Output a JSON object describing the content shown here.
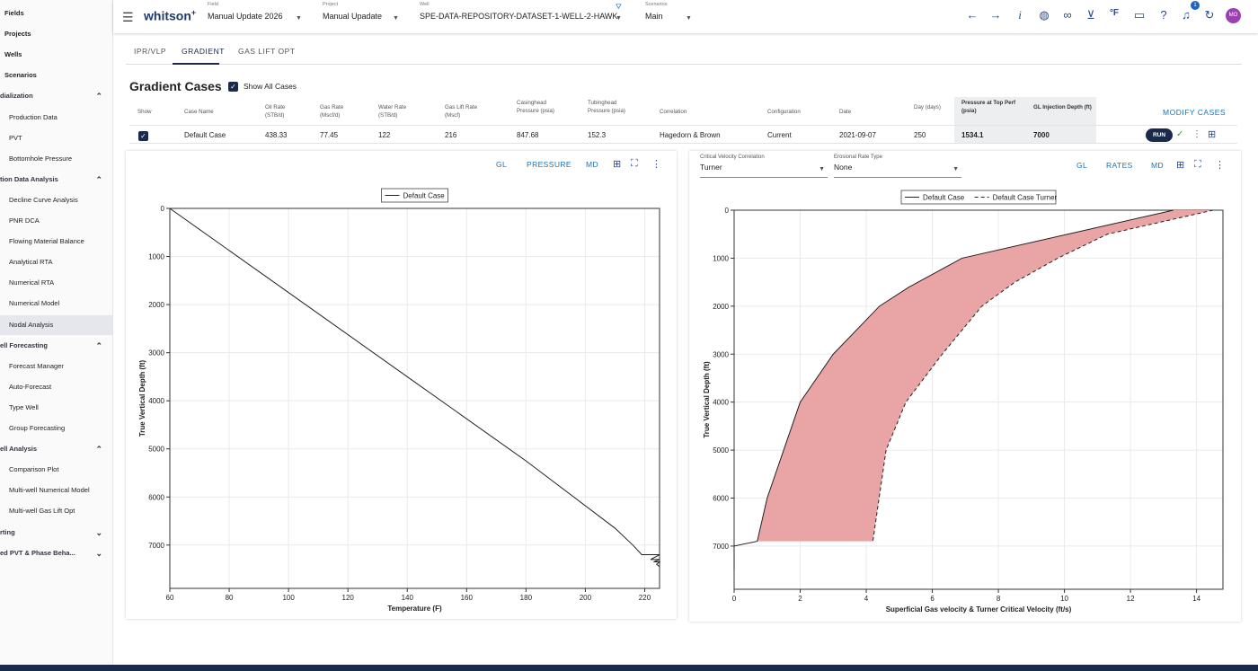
{
  "sidebar": {
    "items": [
      {
        "label": "Fields",
        "kind": "top"
      },
      {
        "label": "Projects",
        "kind": "top"
      },
      {
        "label": "Wells",
        "kind": "top"
      },
      {
        "label": "Scenarios",
        "kind": "top"
      },
      {
        "label": "dialization",
        "kind": "sec",
        "chevron": "⌃"
      },
      {
        "label": "Production Data",
        "kind": "sub"
      },
      {
        "label": "PVT",
        "kind": "sub"
      },
      {
        "label": "Bottomhole Pressure",
        "kind": "sub"
      },
      {
        "label": "tion Data Analysis",
        "kind": "sec",
        "chevron": "⌃"
      },
      {
        "label": "Decline Curve Analysis",
        "kind": "sub"
      },
      {
        "label": "PNR DCA",
        "kind": "sub"
      },
      {
        "label": "Flowing Material Balance",
        "kind": "sub"
      },
      {
        "label": "Analytical RTA",
        "kind": "sub"
      },
      {
        "label": "Numerical RTA",
        "kind": "sub"
      },
      {
        "label": "Numerical Model",
        "kind": "sub"
      },
      {
        "label": "Nodal Analysis",
        "kind": "sub",
        "active": true
      },
      {
        "label": "ell Forecasting",
        "kind": "sec",
        "chevron": "⌃"
      },
      {
        "label": "Forecast Manager",
        "kind": "sub"
      },
      {
        "label": "Auto-Forecast",
        "kind": "sub"
      },
      {
        "label": "Type Well",
        "kind": "sub"
      },
      {
        "label": "Group Forecasting",
        "kind": "sub"
      },
      {
        "label": "ell Analysis",
        "kind": "sec",
        "chevron": "⌃"
      },
      {
        "label": "Comparison Plot",
        "kind": "sub"
      },
      {
        "label": "Multi-well Numerical Model",
        "kind": "sub"
      },
      {
        "label": "Multi-well Gas Lift Opt",
        "kind": "sub"
      },
      {
        "label": "rting",
        "kind": "sec",
        "chevron": "⌄"
      },
      {
        "label": "ed PVT & Phase Beha...",
        "kind": "sec",
        "chevron": "⌄"
      }
    ]
  },
  "topbar": {
    "logo": "whitson",
    "logo_sup": "+",
    "field_label": "Field",
    "field_value": "Manual Update 2026",
    "project_label": "Project",
    "project_value": "Manual Upadate",
    "well_label": "Well",
    "well_value": "SPE-DATA-REPOSITORY-DATASET-1-WELL-2-HAWK",
    "scenarios_label": "Scenarios",
    "scenarios_value": "Main",
    "notif_count": "1",
    "avatar": "MO",
    "icons": [
      "arrow-left-icon",
      "arrow-right-icon",
      "info-icon",
      "globe-icon",
      "link-icon",
      "download-icon",
      "temperature-unit-icon",
      "feedback-icon",
      "help-icon",
      "bell-icon",
      "refresh-icon"
    ],
    "temp_unit": "°F",
    "info_glyph": "i"
  },
  "tabs": [
    "IPR/VLP",
    "GRADIENT",
    "GAS LIFT OPT"
  ],
  "cases": {
    "title": "Gradient Cases",
    "show_all_label": "Show All Cases",
    "modify_label": "MODIFY CASES",
    "run_label": "RUN",
    "headers": [
      "Show",
      "Case Name",
      "Oil Rate (STB/d)",
      "Gas Rate (Mscf/d)",
      "Water Rate (STB/d)",
      "Gas Lift Rate (Mscf)",
      "Casinghead Pressure (psia)",
      "Tubinghead Pressure (psia)",
      "Correlation",
      "Configuration",
      "Date",
      "Day (days)",
      "Pressure at Top Perf (psia)",
      "GL Injection Depth (ft)"
    ],
    "row": [
      "",
      "Default Case",
      "438.33",
      "77.45",
      "122",
      "216",
      "847.68",
      "152.3",
      "Hagedorn & Brown",
      "Current",
      "2021-09-07",
      "250",
      "1534.1",
      "7000"
    ]
  },
  "left_panel": {
    "tools": [
      "GL",
      "PRESSURE",
      "MD"
    ]
  },
  "right_panel": {
    "crit_label": "Critical Velocity Correlation",
    "crit_value": "Turner",
    "eros_label": "Erosional Rate Type",
    "eros_value": "None",
    "tools": [
      "GL",
      "RATES",
      "MD"
    ]
  },
  "chart_data": [
    {
      "type": "line",
      "xlabel": "Temperature (F)",
      "ylabel": "True Vertical Depth (ft)",
      "xlim": [
        60,
        225
      ],
      "ylim": [
        0,
        7900
      ],
      "y_inverted": true,
      "x_ticks": [
        60,
        80,
        100,
        120,
        140,
        160,
        180,
        200,
        220
      ],
      "y_ticks": [
        0,
        1000,
        2000,
        3000,
        4000,
        5000,
        6000,
        7000
      ],
      "legend_position": "top-center",
      "series": [
        {
          "name": "Default Case",
          "style": "solid",
          "x": [
            60,
            100,
            140,
            180,
            210,
            216,
            219,
            225,
            222,
            225,
            223,
            225,
            224,
            225
          ],
          "y": [
            0,
            1750,
            3500,
            5250,
            6650,
            7000,
            7200,
            7200,
            7300,
            7300,
            7350,
            7350,
            7400,
            7450
          ]
        }
      ]
    },
    {
      "type": "line",
      "xlabel": "Superficial Gas velocity & Turner Critical Velocity (ft/s)",
      "ylabel": "True Vertical Depth (ft)",
      "xlim": [
        0,
        14.8
      ],
      "ylim": [
        0,
        7900
      ],
      "y_inverted": true,
      "x_ticks": [
        0,
        2,
        4,
        6,
        8,
        10,
        12,
        14
      ],
      "y_ticks": [
        0,
        1000,
        2000,
        3000,
        4000,
        5000,
        6000,
        7000
      ],
      "legend_position": "top-center",
      "fill_between": "#e9a5a5",
      "series": [
        {
          "name": "Default Case",
          "style": "solid",
          "x": [
            13.3,
            6.9,
            5.3,
            4.4,
            3.0,
            2.0,
            1.5,
            1.0,
            0.7,
            0.0,
            0.0
          ],
          "y": [
            0,
            1000,
            1600,
            2000,
            3000,
            4000,
            5000,
            6000,
            6900,
            7000,
            7500
          ]
        },
        {
          "name": "Default Case Turner",
          "style": "dashed",
          "x": [
            14.5,
            11.3,
            9.8,
            8.5,
            7.5,
            6.3,
            5.2,
            4.6,
            4.2
          ],
          "y": [
            0,
            500,
            1000,
            1500,
            2000,
            3000,
            4000,
            5000,
            6900
          ]
        }
      ]
    }
  ]
}
